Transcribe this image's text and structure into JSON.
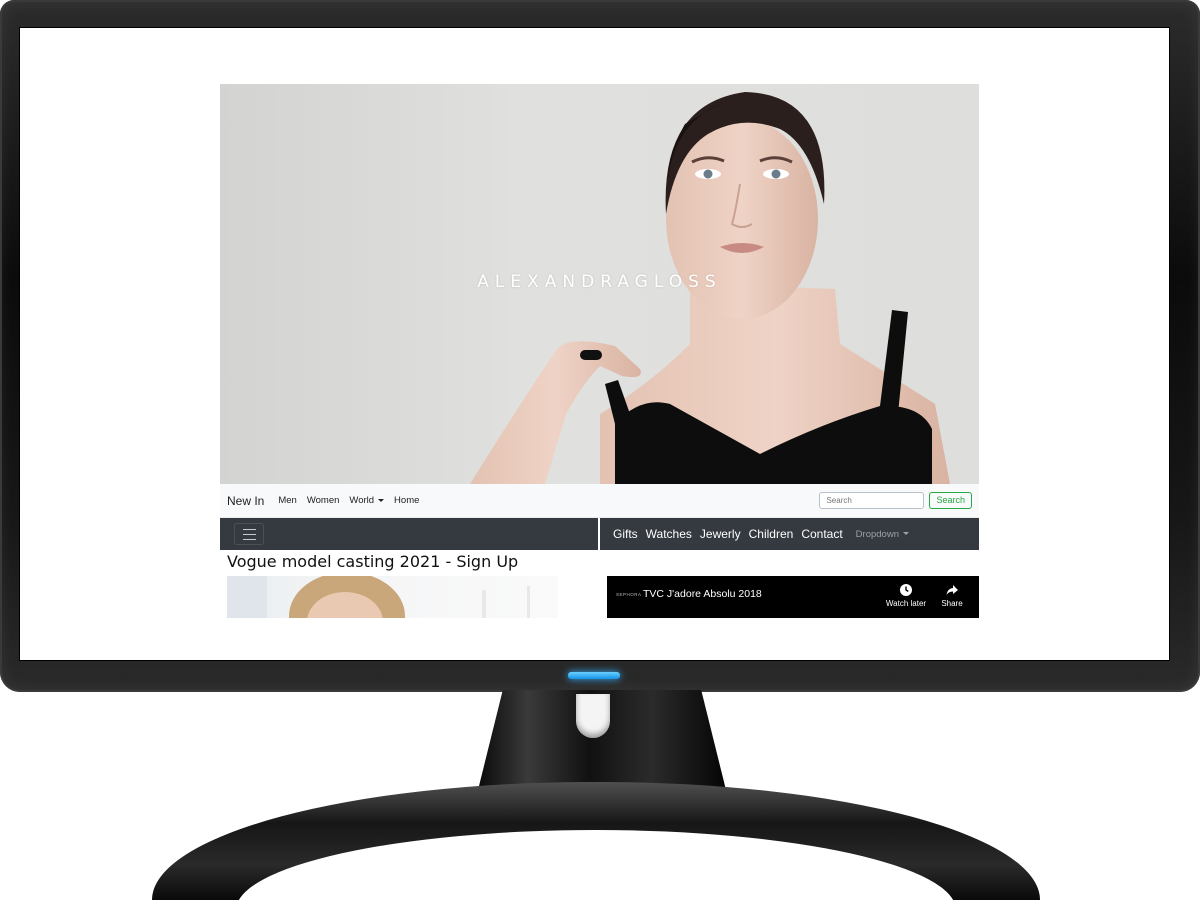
{
  "hero": {
    "brand": "ALEXANDRAGLOSS"
  },
  "navbar_light": {
    "brand": "New In",
    "links": [
      "Men",
      "Women",
      "World",
      "Home"
    ],
    "search_placeholder": "Search",
    "search_button": "Search"
  },
  "navbar_dark": {
    "links": [
      "Gifts",
      "Watches",
      "Jewerly",
      "Children",
      "Contact"
    ],
    "dropdown": "Dropdown"
  },
  "section": {
    "title": "Vogue model casting 2021 - Sign Up"
  },
  "video": {
    "channel": "SEPHORA",
    "title": "TVC J'adore Absolu 2018",
    "watch_later": "Watch later",
    "share": "Share"
  },
  "colors": {
    "dark_nav": "#343a40",
    "light_nav": "#f8f9fa",
    "search_accent": "#28a745",
    "power_led": "#1592e6"
  }
}
